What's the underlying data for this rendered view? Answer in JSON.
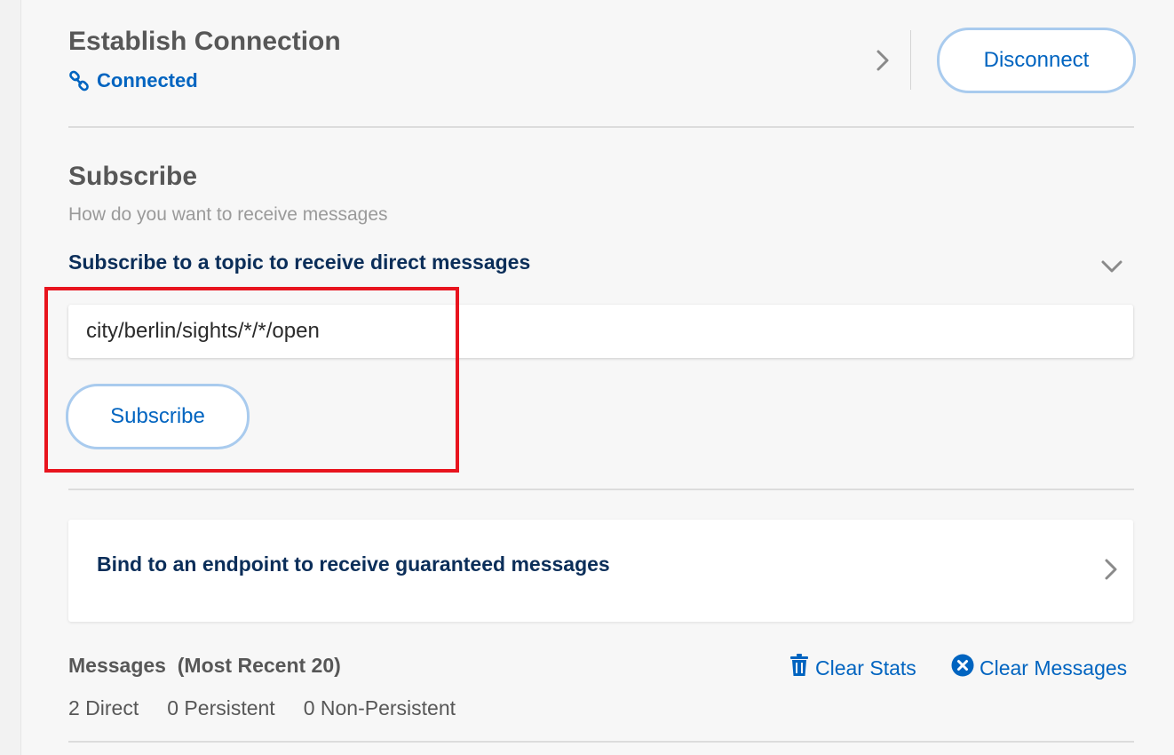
{
  "connection": {
    "title": "Establish Connection",
    "status": "Connected",
    "status_icon": "link-icon",
    "disconnect_label": "Disconnect"
  },
  "subscribe": {
    "title": "Subscribe",
    "description": "How do you want to receive messages",
    "direct_label": "Subscribe to a topic to receive direct messages",
    "topic_value": "city/berlin/sights/*/*/open",
    "button_label": "Subscribe",
    "guaranteed_label": "Bind to an endpoint to receive guaranteed messages"
  },
  "messages": {
    "title": "Messages",
    "subtitle": "(Most Recent 20)",
    "clear_stats_label": "Clear Stats",
    "clear_messages_label": "Clear Messages",
    "counts": [
      "2 Direct",
      "0 Persistent",
      "0 Non-Persistent"
    ]
  },
  "colors": {
    "accent": "#0064c0",
    "heading_navy": "#0b2e59",
    "highlight": "#e8141e",
    "button_border": "#a9cbee"
  }
}
